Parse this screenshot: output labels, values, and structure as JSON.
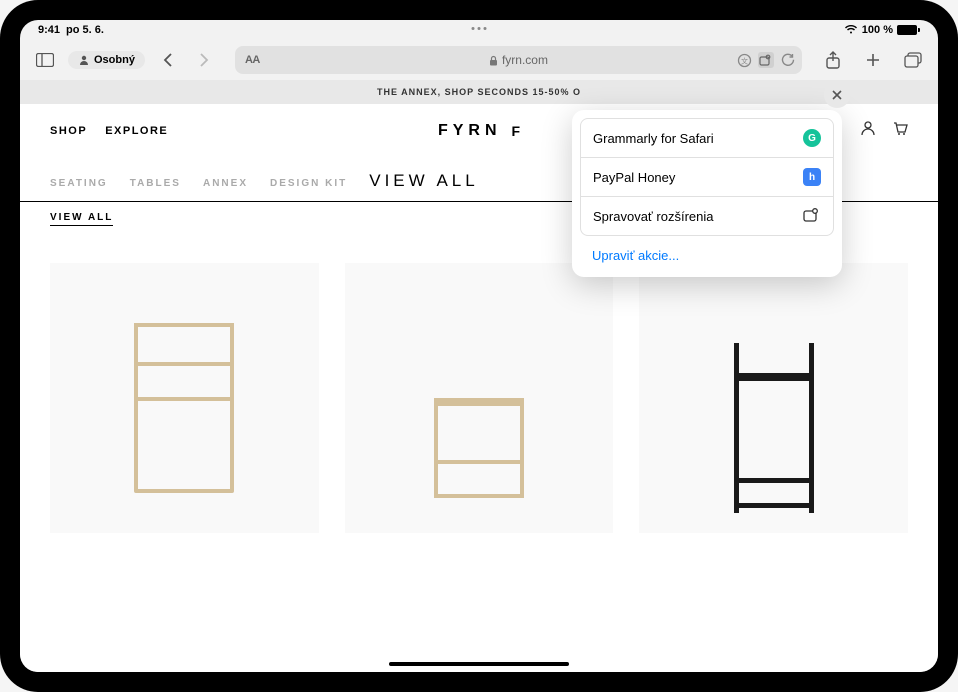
{
  "status": {
    "time": "9:41",
    "date": "po 5. 6.",
    "battery": "100 %"
  },
  "toolbar": {
    "profile": "Osobný",
    "url_text": "fyrn.com",
    "aa": "AA"
  },
  "page": {
    "promo_banner": "THE ANNEX, SHOP SECONDS 15-50% O",
    "nav": {
      "shop": "SHOP",
      "explore": "EXPLORE"
    },
    "logo": "FYRN",
    "logo_mark": "F",
    "categories": [
      "SEATING",
      "TABLES",
      "ANNEX",
      "DESIGN KIT"
    ],
    "category_active": "VIEW ALL",
    "subcategory": "VIEW ALL"
  },
  "popover": {
    "items": [
      {
        "label": "Grammarly for Safari",
        "icon_name": "grammarly-icon",
        "color": "#15c39a",
        "glyph": "G"
      },
      {
        "label": "PayPal Honey",
        "icon_name": "honey-icon",
        "color": "#3b82f6",
        "glyph": "h"
      },
      {
        "label": "Spravovať rozšírenia",
        "icon_name": "puzzle-icon",
        "color": "",
        "glyph": ""
      }
    ],
    "edit_label": "Upraviť akcie..."
  }
}
